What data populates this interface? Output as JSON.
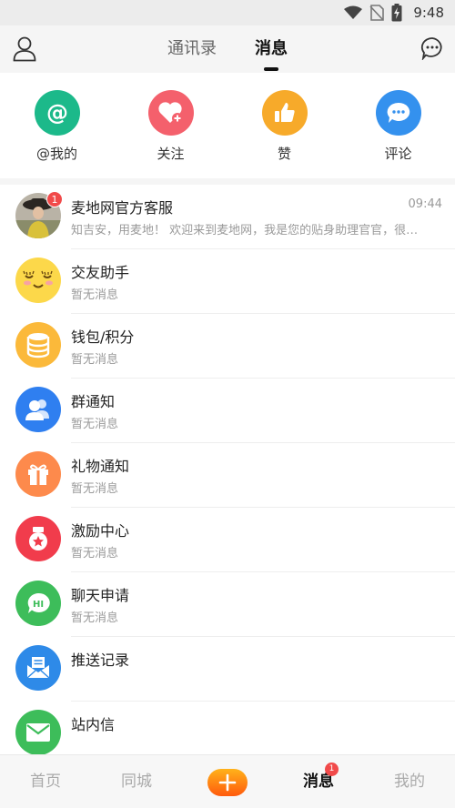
{
  "status_bar": {
    "time": "9:48"
  },
  "header": {
    "tabs": [
      {
        "label": "通讯录",
        "active": false
      },
      {
        "label": "消息",
        "active": true
      }
    ]
  },
  "quick_actions": [
    {
      "label": "@我的",
      "icon": "at-icon",
      "color": "#1cb98a"
    },
    {
      "label": "关注",
      "icon": "heart-plus-icon",
      "color": "#f4606c"
    },
    {
      "label": "赞",
      "icon": "thumbs-up-icon",
      "color": "#f7aa2a"
    },
    {
      "label": "评论",
      "icon": "comment-icon",
      "color": "#3491ee"
    }
  ],
  "messages": [
    {
      "title": "麦地网官方客服",
      "subtitle": "知吉安，用麦地！ 欢迎来到麦地网，我是您的贴身助理官官，很…",
      "time": "09:44",
      "badge": "1",
      "icon": "customer-service-avatar"
    },
    {
      "title": "交友助手",
      "subtitle": "暂无消息",
      "icon": "smiley-face-icon",
      "color": "#fcd84a"
    },
    {
      "title": "钱包/积分",
      "subtitle": "暂无消息",
      "icon": "coin-stack-icon",
      "color": "#fbb93a"
    },
    {
      "title": "群通知",
      "subtitle": "暂无消息",
      "icon": "group-icon",
      "color": "#2f7ff0"
    },
    {
      "title": "礼物通知",
      "subtitle": "暂无消息",
      "icon": "gift-icon",
      "color": "#fd8a4c"
    },
    {
      "title": "激励中心",
      "subtitle": "暂无消息",
      "icon": "medal-icon",
      "color": "#f13c4c"
    },
    {
      "title": "聊天申请",
      "subtitle": "暂无消息",
      "icon": "chat-hi-icon",
      "color": "#3dbd5a"
    },
    {
      "title": "推送记录",
      "subtitle": "",
      "icon": "mail-open-icon",
      "color": "#2e8ae8"
    },
    {
      "title": "站内信",
      "subtitle": "",
      "icon": "envelope-icon",
      "color": "#3dbd5a"
    }
  ],
  "bottom_nav": [
    {
      "label": "首页",
      "active": false
    },
    {
      "label": "同城",
      "active": false
    },
    {
      "label": "",
      "icon": "plus-icon"
    },
    {
      "label": "消息",
      "active": true,
      "badge": "1"
    },
    {
      "label": "我的",
      "active": false
    }
  ]
}
